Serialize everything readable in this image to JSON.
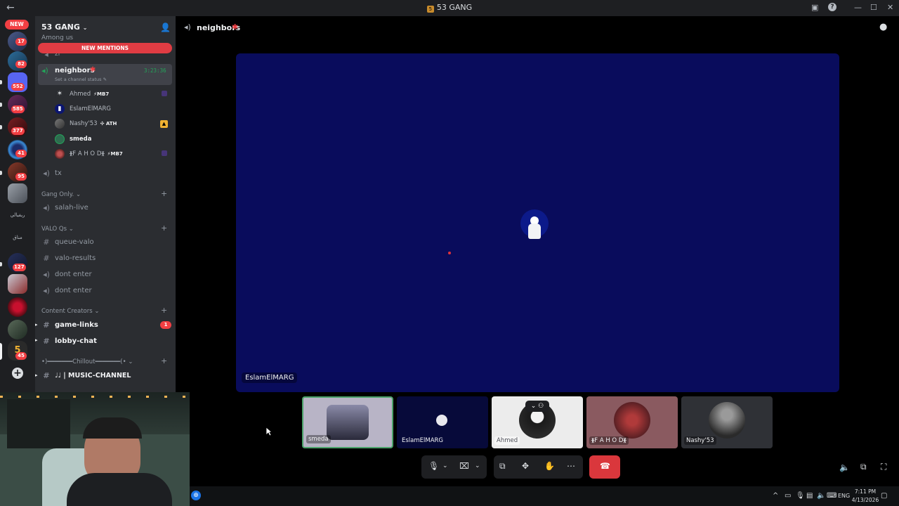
{
  "window": {
    "title": "53 GANG",
    "back_icon": "back-arrow-icon",
    "minimize": "—",
    "maximize": "☐",
    "close": "✕",
    "inbox_icon": "inbox-icon",
    "help_icon": "help-icon"
  },
  "rail": {
    "new_badge": "NEW",
    "badges": [
      "17",
      "82",
      "552",
      "585",
      "377",
      "41",
      "95",
      "127",
      "45"
    ],
    "text_servers": [
      "ريفيالي",
      "مناق"
    ],
    "add_server": "+"
  },
  "server": {
    "name": "53 GANG",
    "new_mentions": "NEW MENTIONS"
  },
  "channels": {
    "among_us": "Among us",
    "zi": "zi",
    "neighbors": "neighbors",
    "neighbors_time": "3:23:36",
    "channel_status": "Set a channel status",
    "tx": "tx",
    "gang_only": "Gang Only.",
    "salah_live": "salah-live",
    "valo_qs": "VALO Qs",
    "queue_valo": "queue-valo",
    "valo_results": "valo-results",
    "dont_enter_1": "dont enter",
    "dont_enter_2": "dont enter",
    "content_creators": "Content Creators",
    "game_links": "game-links",
    "game_links_badge": "1",
    "lobby_chat": "lobby-chat",
    "chillout": "•)━━━━━━━Chillout━━━━━━━(•",
    "music_channel": "♩♩ | MUSIC-CHANNEL"
  },
  "voice_users": [
    {
      "name": "Ahmed",
      "tag": "⚡MB7"
    },
    {
      "name": "EslamElMARG",
      "tag": ""
    },
    {
      "name": "Nashy'53",
      "tag": "✣ ATH"
    },
    {
      "name": "smeda",
      "tag": ""
    },
    {
      "name": "ᚕF A H O Dᚕ",
      "tag": "⚡MB7"
    }
  ],
  "main": {
    "channel": "neighbors",
    "stage_user": "EslamElMARG",
    "tiles": [
      {
        "name": "smeda"
      },
      {
        "name": "EslamElMARG"
      },
      {
        "name": "Ahmed"
      },
      {
        "name": "ᚕF A H O Dᚕ"
      },
      {
        "name": "Nashy'53"
      }
    ]
  },
  "taskbar": {
    "lang": "ENG",
    "time": "7:11 PM",
    "date": "4/13/2026"
  }
}
